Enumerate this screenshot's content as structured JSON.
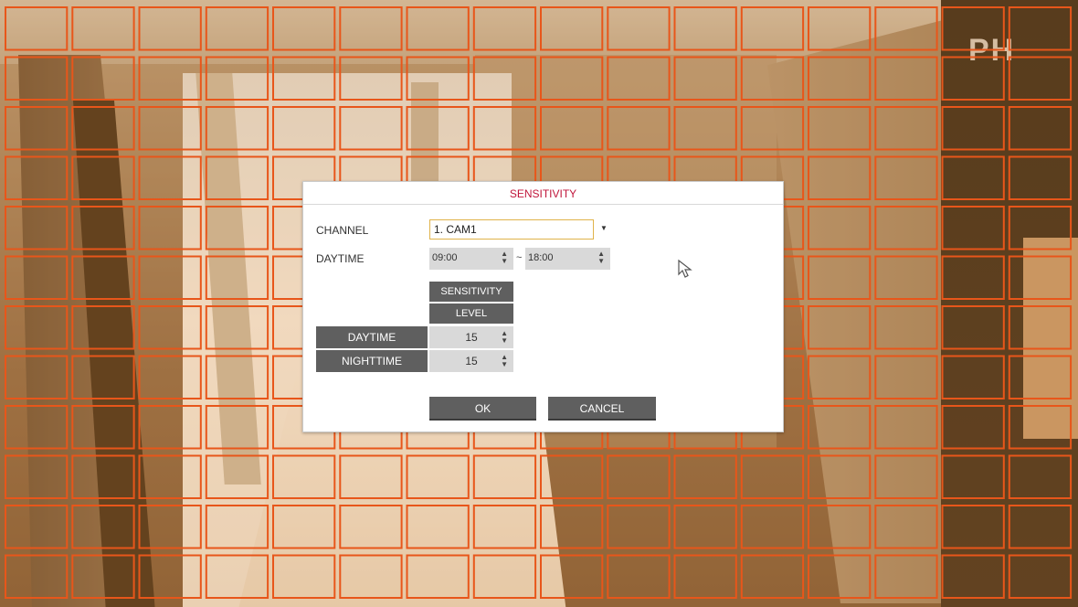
{
  "dialog": {
    "title": "SENSITIVITY",
    "channel_label": "CHANNEL",
    "channel_value": "1. CAM1",
    "daytime_label": "DAYTIME",
    "daytime_start": "09:00",
    "daytime_separator": "~",
    "daytime_end": "18:00",
    "table": {
      "header_line1": "SENSITIVITY",
      "header_line2": "LEVEL",
      "rows": [
        {
          "label": "DAYTIME",
          "level": "15"
        },
        {
          "label": "NIGHTTIME",
          "level": "15"
        }
      ]
    },
    "ok_label": "OK",
    "cancel_label": "CANCEL"
  },
  "background": {
    "sign_text": "PH"
  },
  "motion_grid": {
    "columns": 16,
    "rows": 12,
    "color": "#e8561a"
  },
  "colors": {
    "title": "#c0163b",
    "header_bg": "#5f5f5f",
    "field_bg": "#d9d9d9",
    "focus_border": "#e0b34a"
  },
  "icons": {
    "dropdown": "triangle-down",
    "spinner": "up-down-arrows",
    "cursor": "mouse-pointer"
  }
}
